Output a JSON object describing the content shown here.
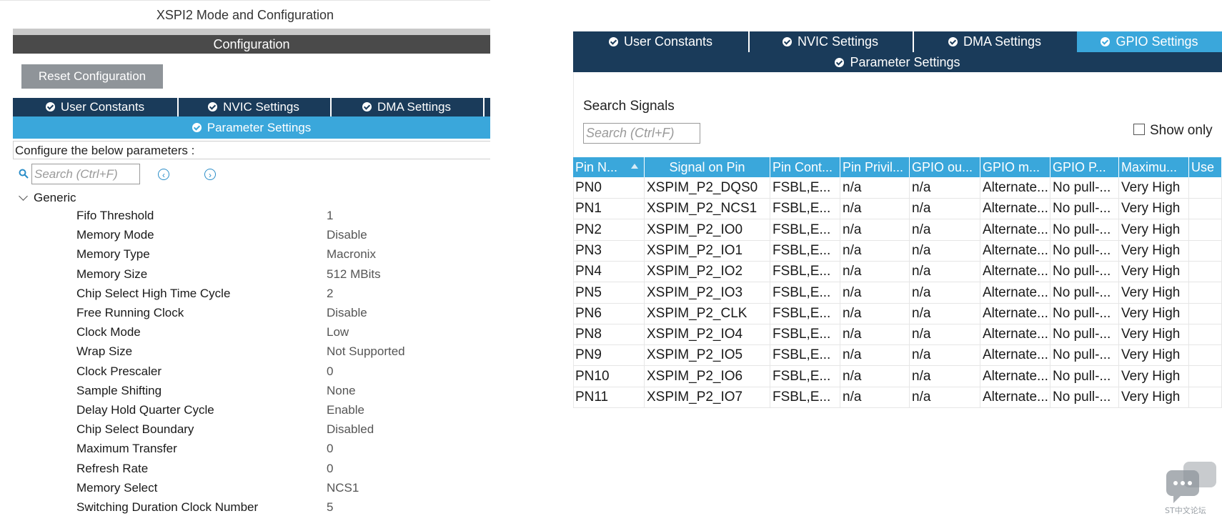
{
  "left": {
    "title": "XSPI2 Mode and Configuration",
    "config_header": "Configuration",
    "reset_button": "Reset Configuration",
    "tabs": [
      "User Constants",
      "NVIC Settings",
      "DMA Settings"
    ],
    "param_tab": "Parameter Settings",
    "configure_label": "Configure the below parameters :",
    "search_placeholder": "Search (Ctrl+F)",
    "nav_prev": "‹",
    "nav_next": "›",
    "group": "Generic",
    "params": [
      {
        "name": "Fifo Threshold",
        "value": "1"
      },
      {
        "name": "Memory Mode",
        "value": "Disable"
      },
      {
        "name": "Memory Type",
        "value": "Macronix"
      },
      {
        "name": "Memory Size",
        "value": "512 MBits"
      },
      {
        "name": "Chip Select High Time Cycle",
        "value": "2"
      },
      {
        "name": "Free Running Clock",
        "value": "Disable"
      },
      {
        "name": "Clock Mode",
        "value": "Low"
      },
      {
        "name": "Wrap Size",
        "value": "Not Supported"
      },
      {
        "name": "Clock Prescaler",
        "value": "0"
      },
      {
        "name": "Sample Shifting",
        "value": "None"
      },
      {
        "name": "Delay Hold Quarter Cycle",
        "value": "Enable"
      },
      {
        "name": "Chip Select Boundary",
        "value": "Disabled"
      },
      {
        "name": "Maximum Transfer",
        "value": "0"
      },
      {
        "name": "Refresh Rate",
        "value": "0"
      },
      {
        "name": "Memory Select",
        "value": "NCS1"
      },
      {
        "name": "Switching Duration Clock Number",
        "value": "5"
      }
    ]
  },
  "right": {
    "tabs": [
      "User Constants",
      "NVIC Settings",
      "DMA Settings",
      "GPIO Settings"
    ],
    "param_tab": "Parameter Settings",
    "search_label": "Search Signals",
    "search_placeholder": "Search (Ctrl+F)",
    "show_only": "Show only",
    "columns": [
      "Pin N...",
      "Signal on Pin",
      "Pin Cont...",
      "Pin Privil...",
      "GPIO ou...",
      "GPIO m...",
      "GPIO P...",
      "Maximu...",
      "Use"
    ],
    "rows": [
      [
        "PN0",
        "XSPIM_P2_DQS0",
        "FSBL,E...",
        "n/a",
        "n/a",
        "Alternate...",
        "No pull-...",
        "Very High",
        ""
      ],
      [
        "PN1",
        "XSPIM_P2_NCS1",
        "FSBL,E...",
        "n/a",
        "n/a",
        "Alternate...",
        "No pull-...",
        "Very High",
        ""
      ],
      [
        "PN2",
        "XSPIM_P2_IO0",
        "FSBL,E...",
        "n/a",
        "n/a",
        "Alternate...",
        "No pull-...",
        "Very High",
        ""
      ],
      [
        "PN3",
        "XSPIM_P2_IO1",
        "FSBL,E...",
        "n/a",
        "n/a",
        "Alternate...",
        "No pull-...",
        "Very High",
        ""
      ],
      [
        "PN4",
        "XSPIM_P2_IO2",
        "FSBL,E...",
        "n/a",
        "n/a",
        "Alternate...",
        "No pull-...",
        "Very High",
        ""
      ],
      [
        "PN5",
        "XSPIM_P2_IO3",
        "FSBL,E...",
        "n/a",
        "n/a",
        "Alternate...",
        "No pull-...",
        "Very High",
        ""
      ],
      [
        "PN6",
        "XSPIM_P2_CLK",
        "FSBL,E...",
        "n/a",
        "n/a",
        "Alternate...",
        "No pull-...",
        "Very High",
        ""
      ],
      [
        "PN8",
        "XSPIM_P2_IO4",
        "FSBL,E...",
        "n/a",
        "n/a",
        "Alternate...",
        "No pull-...",
        "Very High",
        ""
      ],
      [
        "PN9",
        "XSPIM_P2_IO5",
        "FSBL,E...",
        "n/a",
        "n/a",
        "Alternate...",
        "No pull-...",
        "Very High",
        ""
      ],
      [
        "PN10",
        "XSPIM_P2_IO6",
        "FSBL,E...",
        "n/a",
        "n/a",
        "Alternate...",
        "No pull-...",
        "Very High",
        ""
      ],
      [
        "PN11",
        "XSPIM_P2_IO7",
        "FSBL,E...",
        "n/a",
        "n/a",
        "Alternate...",
        "No pull-...",
        "Very High",
        ""
      ]
    ]
  },
  "watermark": "ST中文论坛",
  "colors": {
    "dark_tab": "#1a3b5a",
    "active_tab": "#3aa7db",
    "header_dark": "#4a4a4a",
    "button": "#8f9499"
  }
}
